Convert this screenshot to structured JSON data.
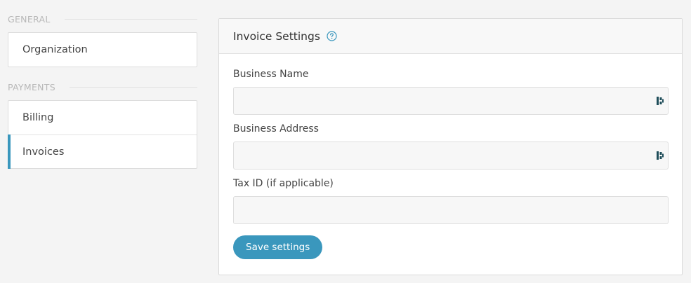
{
  "sidebar": {
    "sections": [
      {
        "header": "General",
        "items": [
          {
            "label": "Organization"
          }
        ]
      },
      {
        "header": "Payments",
        "items": [
          {
            "label": "Billing"
          },
          {
            "label": "Invoices",
            "active": true
          }
        ]
      }
    ]
  },
  "card": {
    "title": "Invoice Settings",
    "help_icon": "question-circle-icon",
    "fields": [
      {
        "label": "Business Name",
        "value": "",
        "placeholder": "",
        "icon": "password-manager-icon"
      },
      {
        "label": "Business Address",
        "value": "",
        "placeholder": "",
        "icon": "password-manager-icon"
      },
      {
        "label": "Tax ID (if applicable)",
        "value": "",
        "placeholder": ""
      }
    ],
    "save_label": "Save settings"
  },
  "colors": {
    "accent": "#3a97bd",
    "background": "#f4f4f4",
    "muted_text": "#b8b8b8"
  }
}
